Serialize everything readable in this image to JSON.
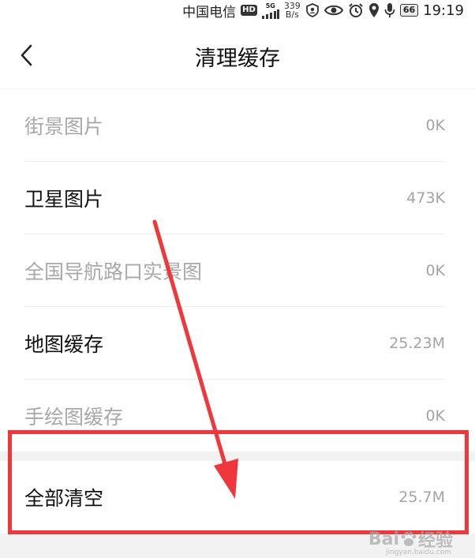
{
  "status_bar": {
    "carrier": "中国电信",
    "hd": "HD",
    "network_gen": "5G",
    "net_speed_value": "339",
    "net_speed_unit": "B/s",
    "battery": "66",
    "time": "19:19"
  },
  "header": {
    "title": "清理缓存"
  },
  "cache_items": [
    {
      "label": "街景图片",
      "size": "0K",
      "enabled": false
    },
    {
      "label": "卫星图片",
      "size": "473K",
      "enabled": true
    },
    {
      "label": "全国导航路口实景图",
      "size": "0K",
      "enabled": false
    },
    {
      "label": "地图缓存",
      "size": "25.23M",
      "enabled": true
    },
    {
      "label": "手绘图缓存",
      "size": "0K",
      "enabled": false
    }
  ],
  "clear_all": {
    "label": "全部清空",
    "size": "25.7M"
  },
  "watermark": {
    "brand": "Bai",
    "suffix": "经验",
    "url": "jingyan.baidu.com"
  },
  "colors": {
    "highlight": "#f0373b",
    "disabled_text": "#a8a8a8",
    "size_text": "#a3a3a3"
  }
}
